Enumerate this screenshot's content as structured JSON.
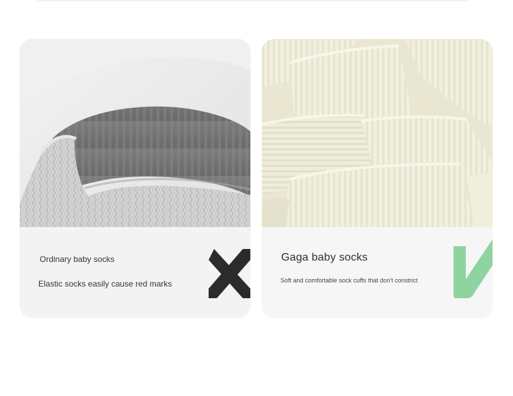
{
  "comparison": {
    "ordinary": {
      "title": "Ordinary baby socks",
      "description": "Elastic socks easily cause red marks",
      "photo_icon": "grey-knit-sock-cuff-photo",
      "mark_icon": "cross-icon",
      "mark_color": "#2b2b2b"
    },
    "gaga": {
      "title": "Gaga baby socks",
      "description": "Soft and comfortable sock cuffs that don't constrict",
      "photo_icon": "cream-ribbed-socks-photo",
      "mark_icon": "check-icon",
      "mark_color": "#8fd3a1"
    }
  }
}
